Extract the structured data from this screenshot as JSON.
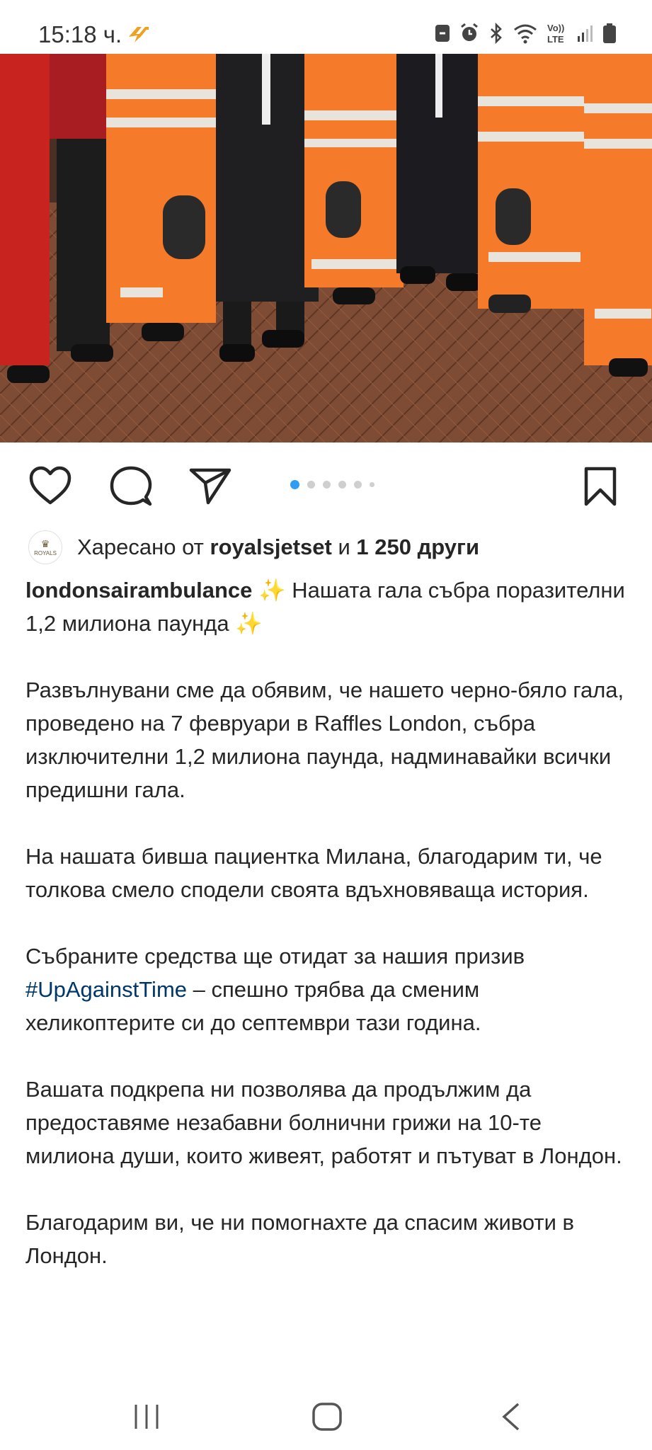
{
  "status_bar": {
    "time": "15:18 ч.",
    "icons": [
      "notification-app-icon",
      "alarm-icon",
      "bluetooth-icon",
      "wifi-icon",
      "volte-icon",
      "signal-icon",
      "battery-icon"
    ],
    "volte_top": "Vo))",
    "volte_bottom": "LTE"
  },
  "post": {
    "image_alt": "Group of people in orange flight suits and dark suits standing on a herringbone wooden floor",
    "carousel": {
      "total": 6,
      "active": 1
    },
    "actions": {
      "icons": [
        "heart-icon",
        "comment-icon",
        "share-icon",
        "bookmark-icon"
      ]
    },
    "likes": {
      "prefix": "Харесано от",
      "user": "royalsjetset",
      "connector": "и",
      "others": "1 250 други",
      "avatar_text": "ROYALS"
    },
    "caption": {
      "username": "londonsairambulance",
      "title": "✨ Нашата гала събра поразителни 1,2 милиона паунда ✨",
      "p1": "Развълнувани сме да обявим, че нашето черно-бяло гала, проведено на 7 февруари в Raffles London, събра изключителни 1,2 милиона паунда, надминавайки всички предишни гала.",
      "p2": "На нашата бивша пациентка Милана, благодарим ти, че толкова смело сподели своята вдъхновяваща история.",
      "p3_before": "Събраните средства ще отидат за нашия призив ",
      "p3_hashtag": "#UpAgainstTime",
      "p3_after": " – спешно трябва да сменим хеликоптерите си до септември тази година.",
      "p4": "Вашата подкрепа ни позволява да продължим да предоставяме незабавни болнични грижи на 10-те милиона души, които живеят, работят и пътуват в Лондон.",
      "p5": "Благодарим ви, че ни помогнахте да спасим животи в Лондон."
    }
  },
  "nav": {
    "icons": [
      "recent-apps-icon",
      "home-icon",
      "back-icon"
    ]
  },
  "colors": {
    "orange_suit": "#f57a2a",
    "reflective": "#e8e4dc",
    "floor": "#7a4a33",
    "accent_blue": "#2f9df4",
    "hashtag": "#00376b"
  }
}
